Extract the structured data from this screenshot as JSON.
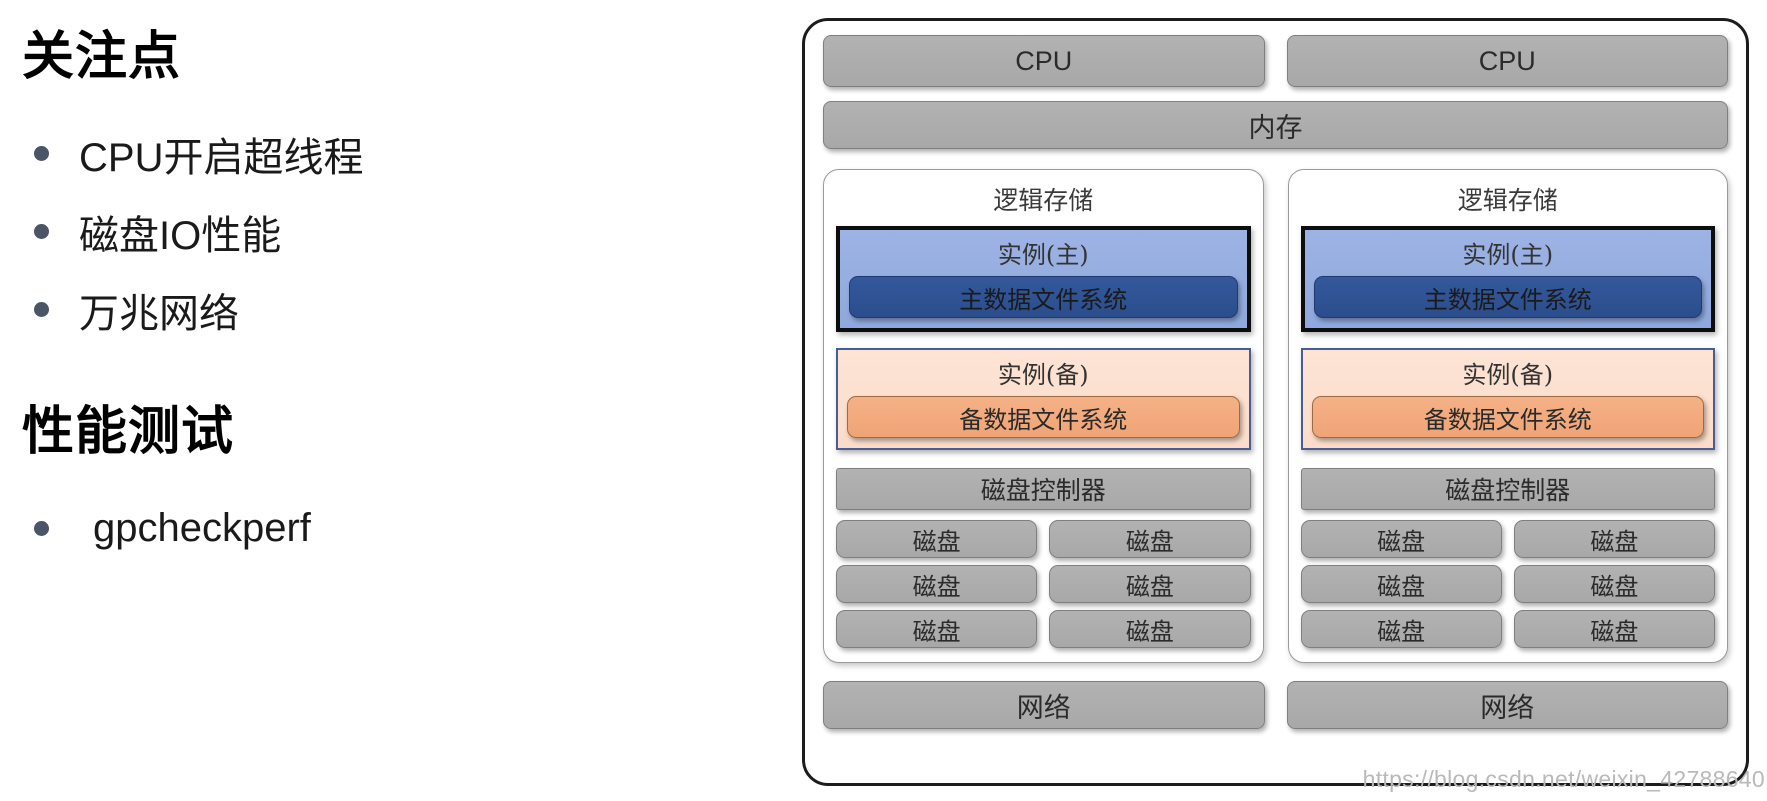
{
  "left_panel": {
    "concerns": {
      "heading": "关注点",
      "items": [
        "CPU开启超线程",
        "磁盘IO性能",
        "万兆网络"
      ]
    },
    "performance": {
      "heading": "性能测试",
      "items": [
        "gpcheckperf"
      ]
    }
  },
  "diagram": {
    "cpu_boxes": [
      "CPU",
      "CPU"
    ],
    "memory_label": "内存",
    "columns": [
      {
        "title": "逻辑存储",
        "primary_instance": {
          "label": "实例(主)",
          "filesystem": "主数据文件系统"
        },
        "standby_instance": {
          "label": "实例(备)",
          "filesystem": "备数据文件系统"
        },
        "disk_controller": "磁盘控制器",
        "disks": [
          "磁盘",
          "磁盘",
          "磁盘",
          "磁盘",
          "磁盘",
          "磁盘"
        ]
      },
      {
        "title": "逻辑存储",
        "primary_instance": {
          "label": "实例(主)",
          "filesystem": "主数据文件系统"
        },
        "standby_instance": {
          "label": "实例(备)",
          "filesystem": "备数据文件系统"
        },
        "disk_controller": "磁盘控制器",
        "disks": [
          "磁盘",
          "磁盘",
          "磁盘",
          "磁盘",
          "磁盘",
          "磁盘"
        ]
      }
    ],
    "network_boxes": [
      "网络",
      "网络"
    ]
  },
  "watermark": "https://blog.csdn.net/weixin_42788640",
  "colors": {
    "box_gray": "#ABABAB",
    "primary_instance_fill": "#94AEDE",
    "primary_fs_fill": "#2E5496",
    "standby_instance_fill": "#FBDFCE",
    "standby_fs_fill": "#F2A97E",
    "bullet_dot": "#4A5568",
    "outer_border": "#1C1C1C"
  }
}
